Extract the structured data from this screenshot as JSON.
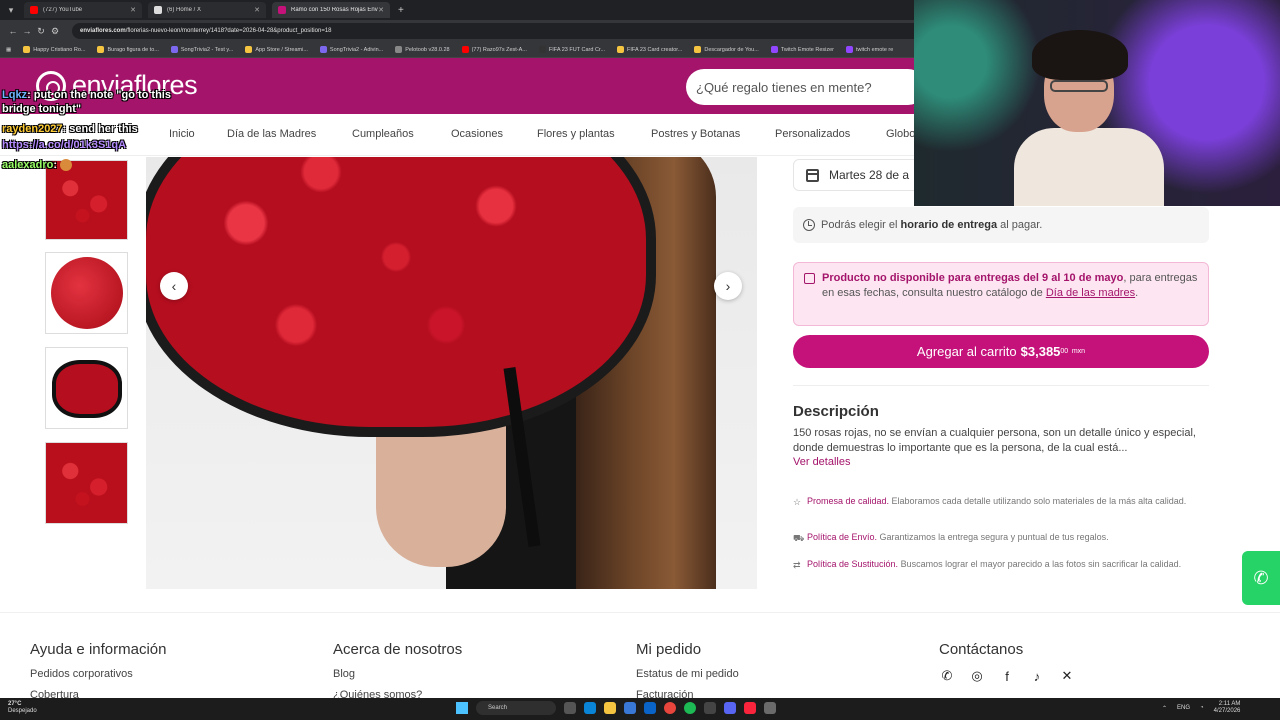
{
  "browser": {
    "tabs": [
      {
        "label": "(727) YouTube",
        "color": "#ff0000",
        "active": false
      },
      {
        "label": "(6) Home / X",
        "color": "#dddddd",
        "active": false
      },
      {
        "label": "Ramo con 150 Rosas Rojas Env",
        "color": "#c4127a",
        "active": true
      }
    ],
    "new_tab_icon": "+",
    "url_site": "enviaflores.com",
    "url_path": "/florerias-nuevo-leon/monterrey/1418?date=2026-04-28&product_position=18",
    "bookmarks": [
      "Happy Cristiano Ro...",
      "Burago figura de to...",
      "SongTrivia2 - Test y...",
      "App Store / Streami...",
      "SongTrivia2 - Adivin...",
      "Pelotoob v28.0.28",
      "(77) Razo97s Zest-A...",
      "FIFA 23 FUT Card Cr...",
      "FIFA 23 Card creator...",
      "Descargador de You...",
      "Twitch Emote Resizer",
      "twitch emote re"
    ]
  },
  "site": {
    "logo": "enviaflores",
    "search_placeholder": "¿Qué regalo tienes en mente?",
    "brand_color": "#a4146b",
    "nav": [
      "Inicio",
      "Día de las Madres",
      "Cumpleaños",
      "Ocasiones",
      "Flores y plantas",
      "Postres y Botanas",
      "Personalizados",
      "Globo"
    ]
  },
  "chat": [
    {
      "user": "Lqkz",
      "text": ": put on the note \"go to this bridge tonight\""
    },
    {
      "user": "rayden2027",
      "text": ": send her this"
    },
    {
      "link": "https://a.co/d/01k3S1qA"
    },
    {
      "user": "aalexadro",
      "text": ":"
    }
  ],
  "gallery": {
    "prev_icon": "‹",
    "next_icon": "›"
  },
  "product": {
    "date": "Martes 28 de a",
    "delivery_info_prefix": "Podrás elegir el",
    "delivery_info_bold": "horario de entrega",
    "delivery_info_suffix": "al pagar.",
    "alert_bold": "Producto no disponible para entregas del 9 al 10 de mayo",
    "alert_text": ", para entregas en esas fechas, consulta nuestro catálogo de",
    "alert_link": "Día de las madres",
    "alert_end": ".",
    "cart_label": "Agregar al carrito",
    "price": "$3,385",
    "price_cents": "00",
    "price_currency": "mxn",
    "description_title": "Descripción",
    "description_text": "150 rosas rojas, no se envían a cualquier persona, son un detalle único y especial, donde demuestras lo importante que es la persona, de la cual está...",
    "see_more": "Ver detalles",
    "policies": [
      {
        "icon": "star-icon",
        "link": "Promesa de calidad.",
        "text": " Elaboramos cada detalle utilizando solo materiales de la más alta calidad."
      },
      {
        "icon": "truck-icon",
        "link": "Política de Envío.",
        "text": " Garantizamos la entrega segura y puntual de tus regalos."
      },
      {
        "icon": "swap-icon",
        "link": "Política de Sustitución.",
        "text": " Buscamos lograr el mayor parecido a las fotos sin sacrificar la calidad."
      }
    ]
  },
  "footer": {
    "col1": {
      "title": "Ayuda e información",
      "links": [
        "Pedidos corporativos",
        "Cobertura"
      ]
    },
    "col2": {
      "title": "Acerca de nosotros",
      "links": [
        "Blog",
        "¿Quiénes somos?"
      ]
    },
    "col3": {
      "title": "Mi pedido",
      "links": [
        "Estatus de mi pedido",
        "Facturación"
      ]
    },
    "col4": {
      "title": "Contáctanos"
    }
  },
  "taskbar": {
    "temperature": "27°C",
    "weather": "Despejado",
    "search": "Search",
    "lang": "ENG",
    "time": "2:11 AM",
    "date": "4/27/2026"
  }
}
